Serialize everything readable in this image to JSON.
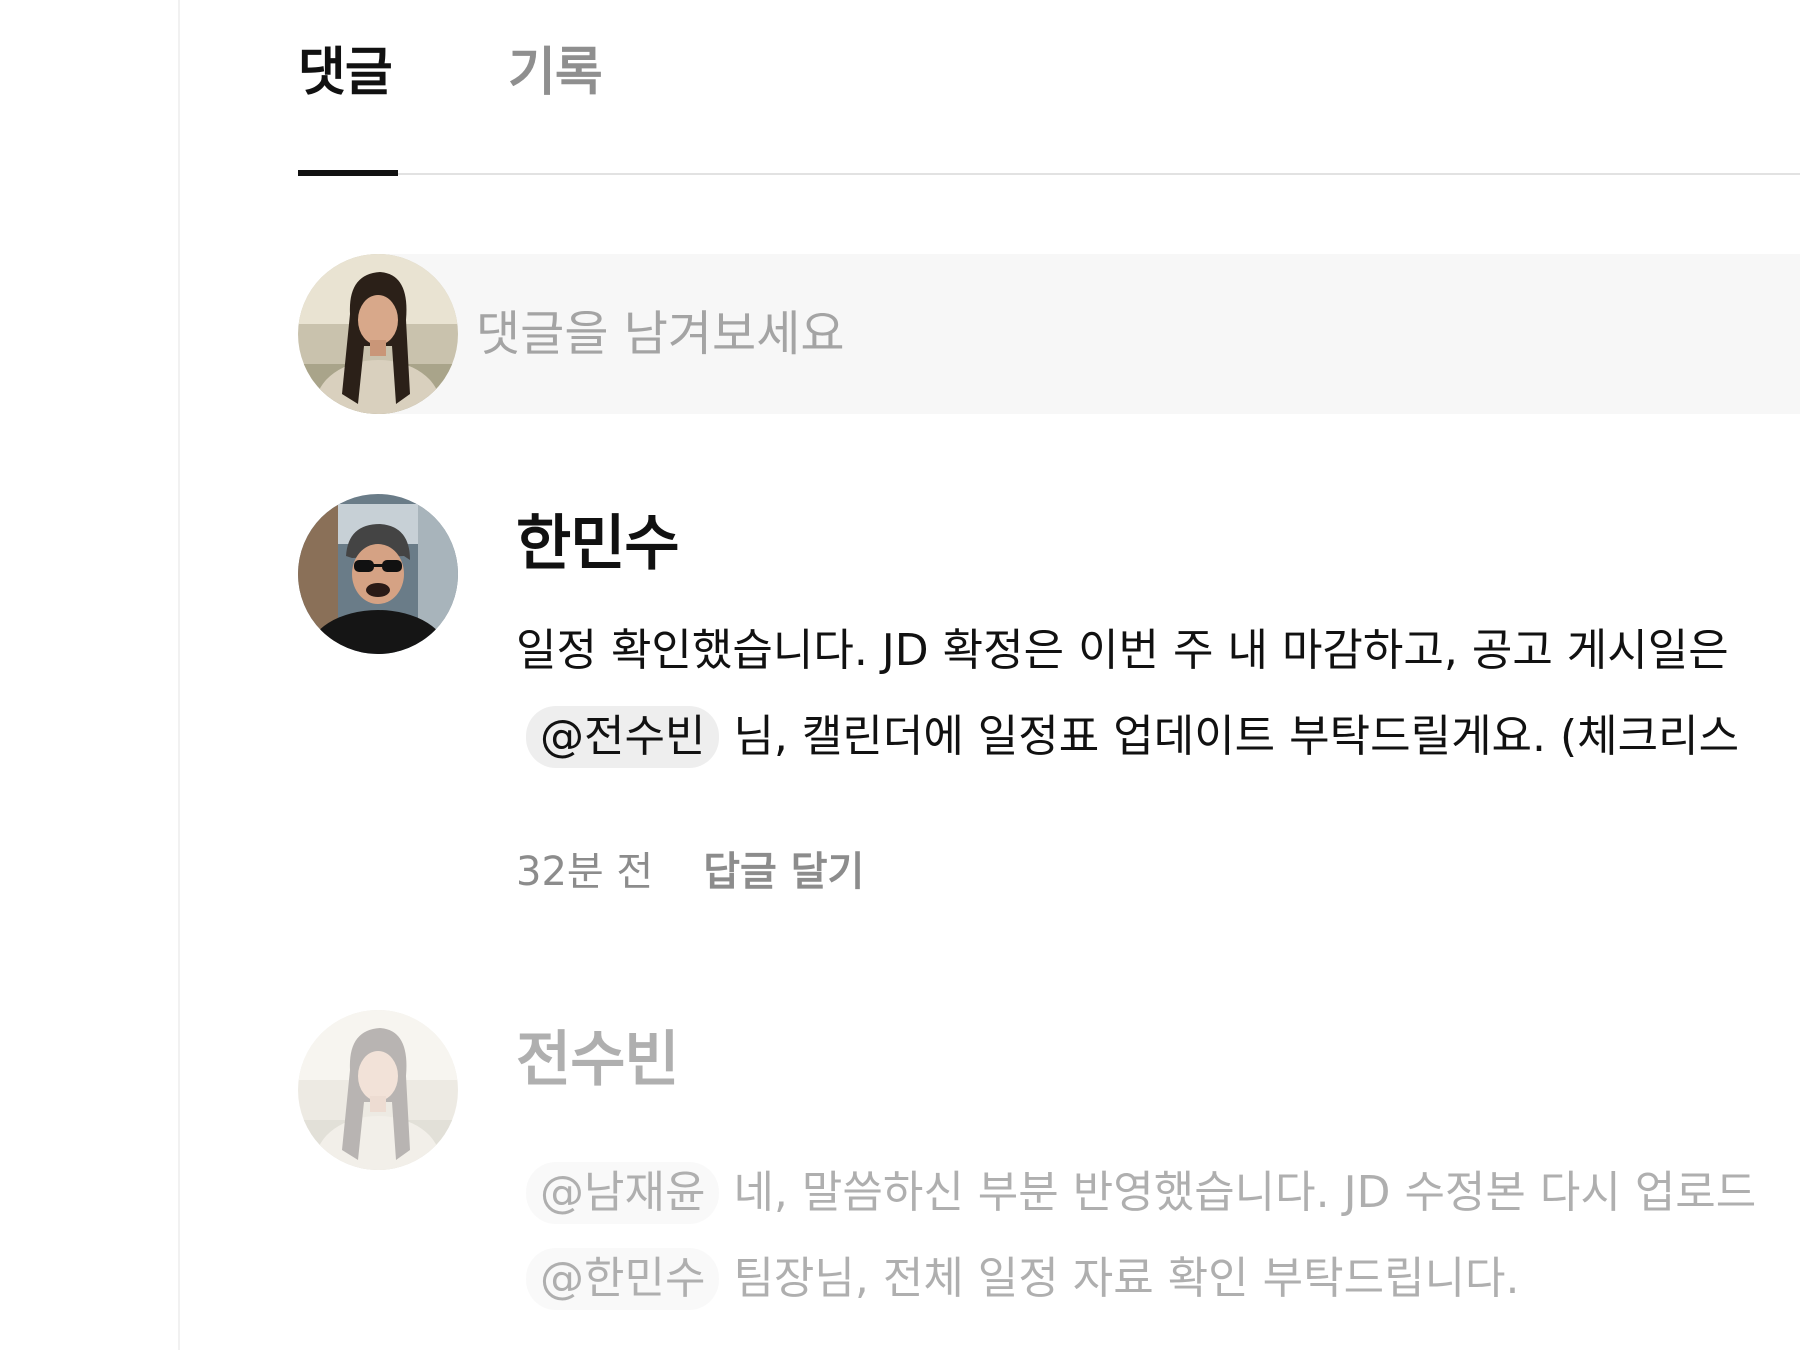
{
  "tabs": [
    {
      "label": "댓글",
      "active": true
    },
    {
      "label": "기록",
      "active": false
    }
  ],
  "composer": {
    "placeholder": "댓글을 남겨보세요"
  },
  "comments": [
    {
      "author": "한민수",
      "lines": [
        {
          "mention": "",
          "text": "일정 확인했습니다. JD 확정은 이번 주 내 마감하고, 공고 게시일은"
        },
        {
          "mention": "@전수빈",
          "text": "님, 캘린더에 일정표 업데이트 부탁드릴게요. (체크리스"
        }
      ],
      "time": "32분 전",
      "reply_label": "답글 달기"
    },
    {
      "author": "전수빈",
      "lines": [
        {
          "mention": "@남재윤",
          "text": "네, 말씀하신 부분 반영했습니다. JD 수정본 다시 업로드"
        },
        {
          "mention": "@한민수",
          "text": "팀장님, 전체 일정 자료 확인 부탁드립니다."
        }
      ]
    }
  ],
  "colors": {
    "active_tab": "#111111",
    "inactive_tab": "#8f8f8f",
    "composer_bg": "#f7f7f7",
    "mention_bg": "#eeeeee",
    "meta_text": "#8c8c8c"
  }
}
